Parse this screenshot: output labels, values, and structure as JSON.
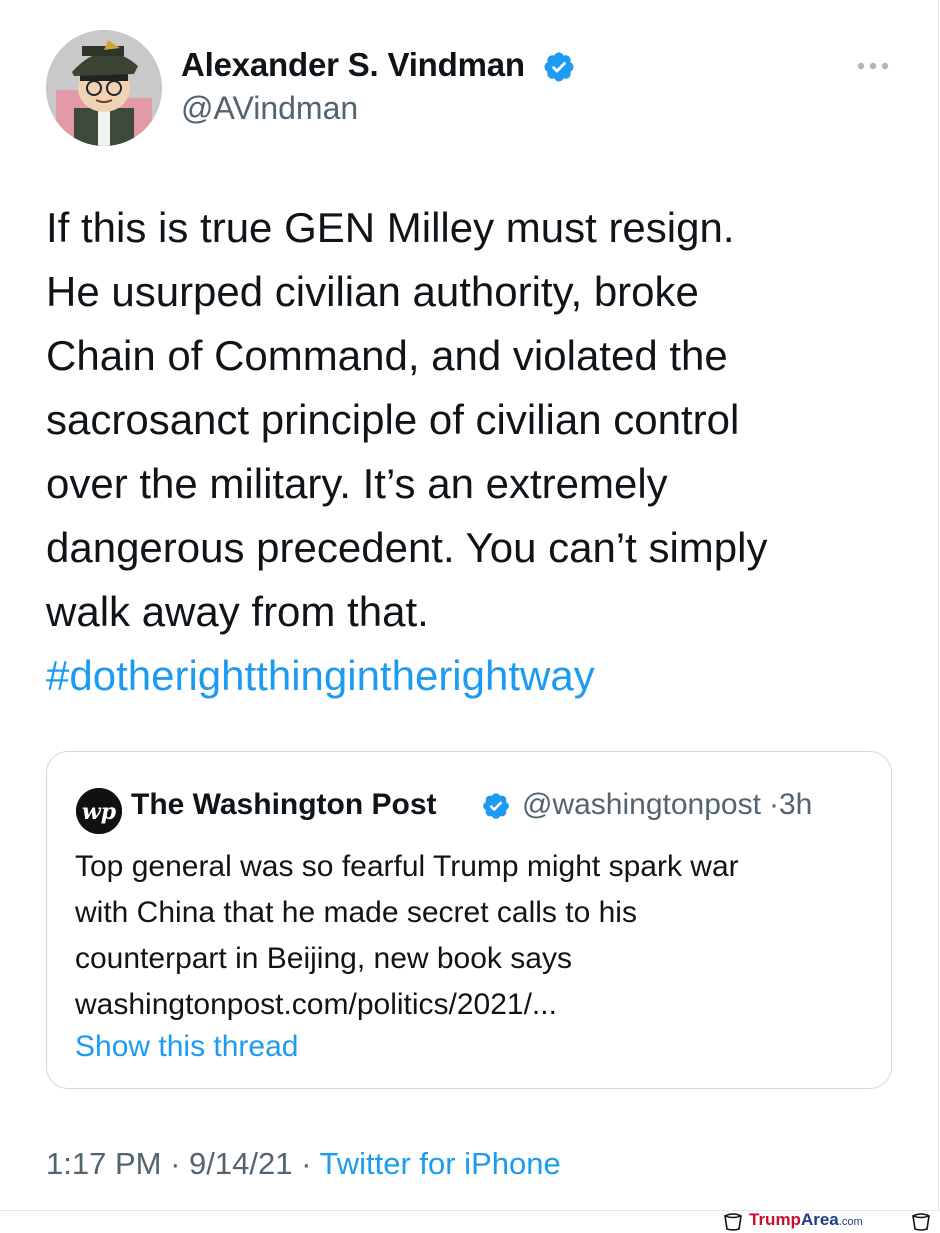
{
  "author": {
    "name": "Alexander S. Vindman",
    "handle": "@AVindman",
    "verified": true
  },
  "tweet": {
    "lines": [
      "If this is true GEN Milley must resign.",
      "He usurped civilian authority, broke",
      "Chain of Command, and violated the",
      "sacrosanct principle of civilian control",
      "over the military. It’s an extremely",
      "dangerous precedent. You can’t simply",
      "walk away from that."
    ],
    "hashtag": "#dotherightthingintherightway"
  },
  "quoted_tweet": {
    "author_name": "The Washington Post",
    "author_handle": "@washingtonpost",
    "separator": "·",
    "time_ago": "3h",
    "verified": true,
    "logo_text": "wp",
    "lines": [
      "Top general was so fearful Trump might spark war",
      "with China that he made secret calls to his",
      "counterpart in Beijing, new book says",
      "washingtonpost.com/politics/2021/..."
    ],
    "show_thread_label": "Show this thread"
  },
  "footer": {
    "time": "1:17 PM",
    "separator": "·",
    "date": "9/14/21",
    "source": "Twitter for iPhone"
  },
  "watermark": {
    "part1": "Trump",
    "part2": "Area",
    "part3": ".com"
  },
  "colors": {
    "link_blue": "#1d9bf0",
    "muted_gray": "#536471",
    "text": "#0f1419",
    "card_border": "#cfd9de"
  },
  "icons": {
    "verified": "verified-badge-icon",
    "more": "more-horizontal-icon",
    "watermark": "bucket-icon"
  }
}
